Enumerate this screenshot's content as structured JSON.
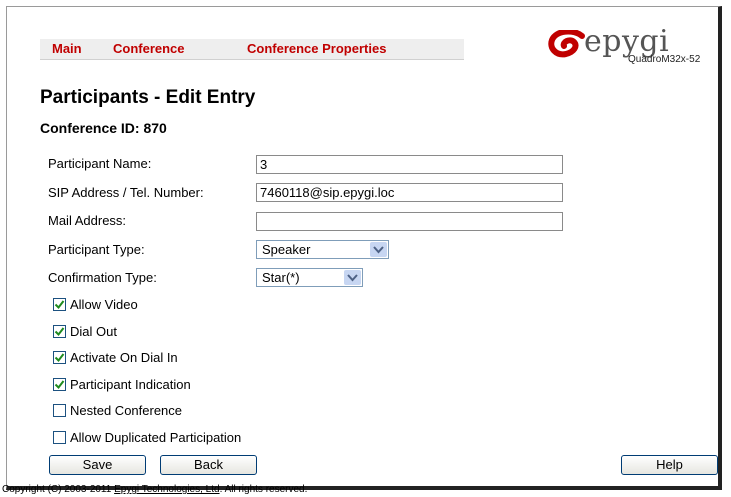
{
  "nav": {
    "main": "Main",
    "conference": "Conference",
    "conference_properties": "Conference Properties"
  },
  "logo": {
    "brand": "epygi",
    "model": "QuadroM32x-52"
  },
  "page": {
    "title": "Participants - Edit Entry",
    "conference_id": "Conference ID: 870"
  },
  "form": {
    "participant_name": {
      "label": "Participant Name:",
      "value": "3"
    },
    "sip_address": {
      "label": "SIP Address / Tel. Number:",
      "value": "7460118@sip.epygi.loc"
    },
    "mail_address": {
      "label": "Mail Address:",
      "value": ""
    },
    "participant_type": {
      "label": "Participant Type:",
      "value": "Speaker"
    },
    "confirmation_type": {
      "label": "Confirmation Type:",
      "value": "Star(*)"
    }
  },
  "checkboxes": [
    {
      "label": "Allow Video",
      "checked": true
    },
    {
      "label": "Dial Out",
      "checked": true
    },
    {
      "label": "Activate On Dial In",
      "checked": true
    },
    {
      "label": "Participant Indication",
      "checked": true
    },
    {
      "label": "Nested Conference",
      "checked": false
    },
    {
      "label": "Allow Duplicated Participation",
      "checked": false
    }
  ],
  "buttons": {
    "save": "Save",
    "back": "Back",
    "help": "Help"
  },
  "footer": {
    "prefix": "Copyright (C) 2003-2011 ",
    "link": "Epygi Technologies, Ltd",
    "suffix": ". All rights reserved."
  },
  "colors": {
    "nav_link": "#c00000",
    "logo_red": "#c00000",
    "checkbox_tick": "#1e8a1e"
  }
}
